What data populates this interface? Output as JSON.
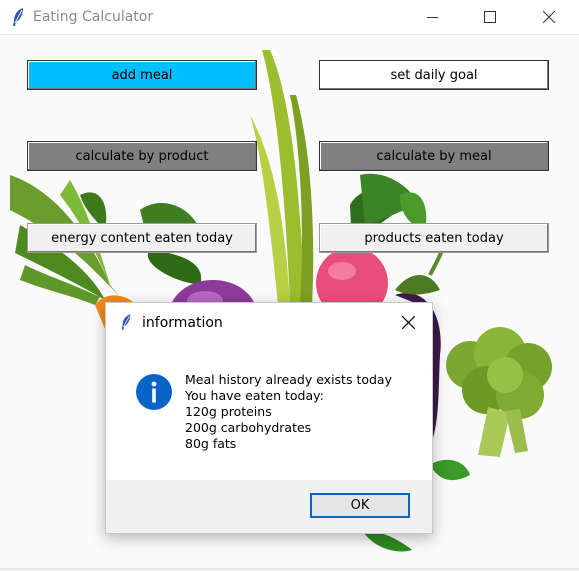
{
  "window": {
    "title": "Eating Calculator",
    "controls": [
      "minimize",
      "maximize",
      "close"
    ]
  },
  "buttons": {
    "add_meal": "add meal",
    "set_daily_goal": "set daily goal",
    "calculate_by_product": "calculate by product",
    "calculate_by_meal": "calculate by meal",
    "energy_content": "energy content eaten today",
    "products_eaten": "products eaten today"
  },
  "dialog": {
    "title": "information",
    "icon": "info-icon",
    "lines": [
      "Meal history already exists today",
      "You have eaten today:",
      "120g proteins",
      "200g carbohydrates",
      "80g fats"
    ],
    "ok_label": "OK"
  },
  "colors": {
    "add_meal_bg": "#00bfff",
    "calc_buttons_bg": "#808080",
    "info_icon": "#0a64c8"
  }
}
